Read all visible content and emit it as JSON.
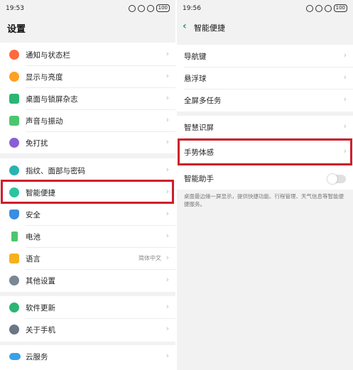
{
  "left": {
    "status": {
      "time": "19:53"
    },
    "title": "设置",
    "groups": [
      {
        "items": [
          {
            "label": "通知与状态栏",
            "icon": "bell-icon",
            "color": "#ff6a3d"
          },
          {
            "label": "显示与亮度",
            "icon": "brightness-icon",
            "color": "#ffa020"
          },
          {
            "label": "桌面与锁屏杂志",
            "icon": "wallpaper-icon",
            "color": "#2bb673"
          },
          {
            "label": "声音与振动",
            "icon": "speaker-icon",
            "color": "#4cc66e"
          },
          {
            "label": "免打扰",
            "icon": "moon-icon",
            "color": "#8a5fd6"
          }
        ]
      },
      {
        "items": [
          {
            "label": "指纹、面部与密码",
            "icon": "fingerprint-icon",
            "color": "#2ab3b0"
          },
          {
            "label": "智能便捷",
            "icon": "smart-icon",
            "color": "#2bc4a0"
          },
          {
            "label": "安全",
            "icon": "shield-icon",
            "color": "#3a8de0"
          },
          {
            "label": "电池",
            "icon": "battery-icon",
            "color": "#4cc66e"
          },
          {
            "label": "语言",
            "icon": "language-icon",
            "color": "#f5b21e",
            "value": "简体中文"
          },
          {
            "label": "其他设置",
            "icon": "gear-icon",
            "color": "#7a8794"
          }
        ]
      },
      {
        "items": [
          {
            "label": "软件更新",
            "icon": "update-icon",
            "color": "#2bb673"
          },
          {
            "label": "关于手机",
            "icon": "info-icon",
            "color": "#6b7785"
          }
        ]
      },
      {
        "items": [
          {
            "label": "云服务",
            "icon": "cloud-icon",
            "color": "#3aa0e8"
          }
        ]
      }
    ]
  },
  "right": {
    "status": {
      "time": "19:56"
    },
    "back": "‹",
    "title": "智能便捷",
    "groups": [
      {
        "items": [
          {
            "label": "导航键"
          },
          {
            "label": "悬浮球"
          },
          {
            "label": "全屏多任务"
          }
        ]
      },
      {
        "items": [
          {
            "label": "智慧识屏"
          },
          {
            "label": "手势体感"
          },
          {
            "label": "智能助手"
          }
        ]
      }
    ],
    "description": "桌面最边缘一屏显示，提供快捷功能、行程管理、天气信息等智能便捷服务。"
  },
  "battery_text": "100",
  "chevron": "›",
  "colors": {
    "accent": "#1a9b78",
    "highlight": "#cc1f2a"
  }
}
